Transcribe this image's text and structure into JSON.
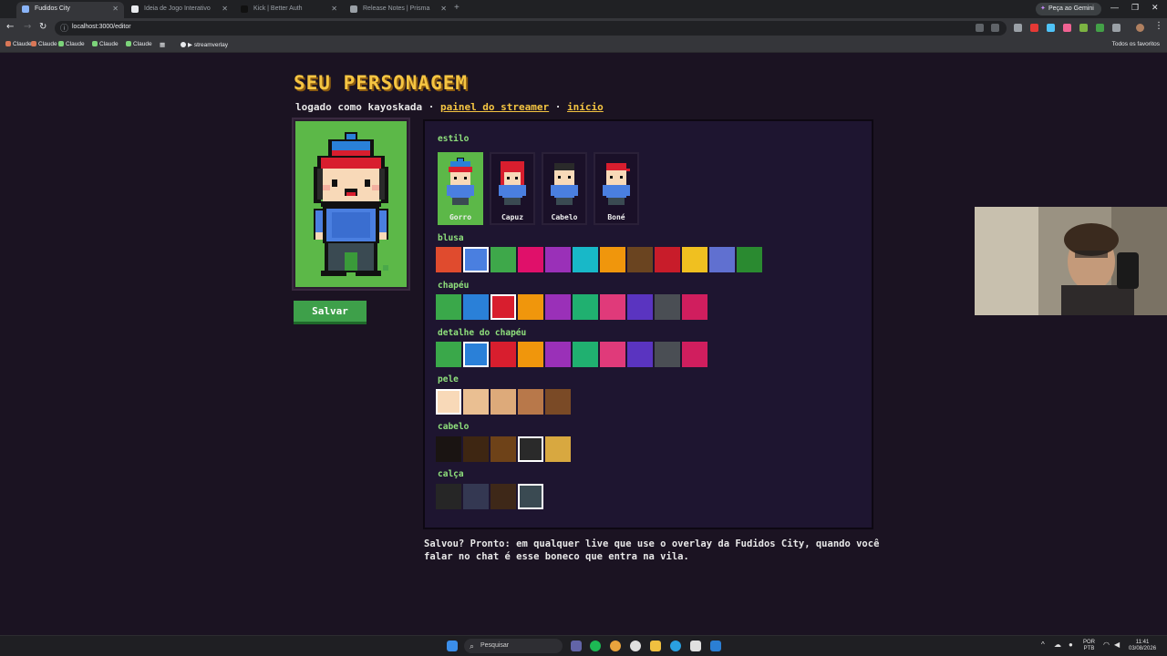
{
  "browser": {
    "tabs": [
      {
        "title": "Fudidos City",
        "active": true
      },
      {
        "title": "Ideia de Jogo Interativo",
        "active": false
      },
      {
        "title": "Kick | Better Auth",
        "active": false
      },
      {
        "title": "Release Notes | Prisma",
        "active": false
      }
    ],
    "gemini_button": "Peça ao Gemini",
    "url": "localhost:3000/editor",
    "bookmarks": [
      "Claude",
      "Claude",
      "Claude",
      "Claude",
      "Claude",
      "streamverlay"
    ],
    "all_bookmarks": "Todos os favoritos"
  },
  "page": {
    "title": "SEU PERSONAGEM",
    "subtitle_prefix": "logado como kayoskada ·",
    "link_panel": "painel do streamer",
    "separator": "·",
    "link_home": "início",
    "save_button": "Salvar",
    "footnote": "Salvou? Pronto: em qualquer live que use o overlay da Fudidos City, quando você falar no chat é esse boneco que entra na vila."
  },
  "editor": {
    "sections": {
      "style": "estilo",
      "shirt": "blusa",
      "hat": "chapéu",
      "hat_detail": "detalhe do chapéu",
      "skin": "pele",
      "hair": "cabelo",
      "pants": "calça"
    },
    "styles": [
      {
        "label": "Gorro",
        "selected": true
      },
      {
        "label": "Capuz",
        "selected": false
      },
      {
        "label": "Cabelo",
        "selected": false
      },
      {
        "label": "Boné",
        "selected": false
      }
    ],
    "shirt_colors": [
      "#e04b2e",
      "#4a7fe0",
      "#3ea84a",
      "#e0106a",
      "#9a30b8",
      "#18b8c8",
      "#f0960c",
      "#6a4420",
      "#c81c2a",
      "#f0c020",
      "#6070d0",
      "#2a8a30"
    ],
    "shirt_selected": 1,
    "hat_colors": [
      "#3aa84a",
      "#2a80d8",
      "#d81e2e",
      "#f0960c",
      "#9a30b8",
      "#20b070",
      "#e03a7a",
      "#5a34c0",
      "#4a4e54",
      "#d01e5e"
    ],
    "hat_selected": 2,
    "hat_detail_colors": [
      "#3aa84a",
      "#2a80d8",
      "#d81e2e",
      "#f0960c",
      "#9a30b8",
      "#20b070",
      "#e03a7a",
      "#5a34c0",
      "#4a4e54",
      "#d01e5e"
    ],
    "hat_detail_selected": 1,
    "skin_colors": [
      "#f8d9b8",
      "#eabf92",
      "#ddaa7a",
      "#b8784a",
      "#7a4a26"
    ],
    "skin_selected": 0,
    "hair_colors": [
      "#1a1412",
      "#3e2612",
      "#6e4218",
      "#2a2a2a",
      "#d8a840"
    ],
    "hair_selected": 3,
    "pants_colors": [
      "#262626",
      "#343852",
      "#3e2818",
      "#3a4a52"
    ],
    "pants_selected": 3
  },
  "taskbar": {
    "search": "Pesquisar",
    "lang": "POR",
    "lang2": "PTB",
    "time": "11:41",
    "date": "03/08/2026"
  }
}
